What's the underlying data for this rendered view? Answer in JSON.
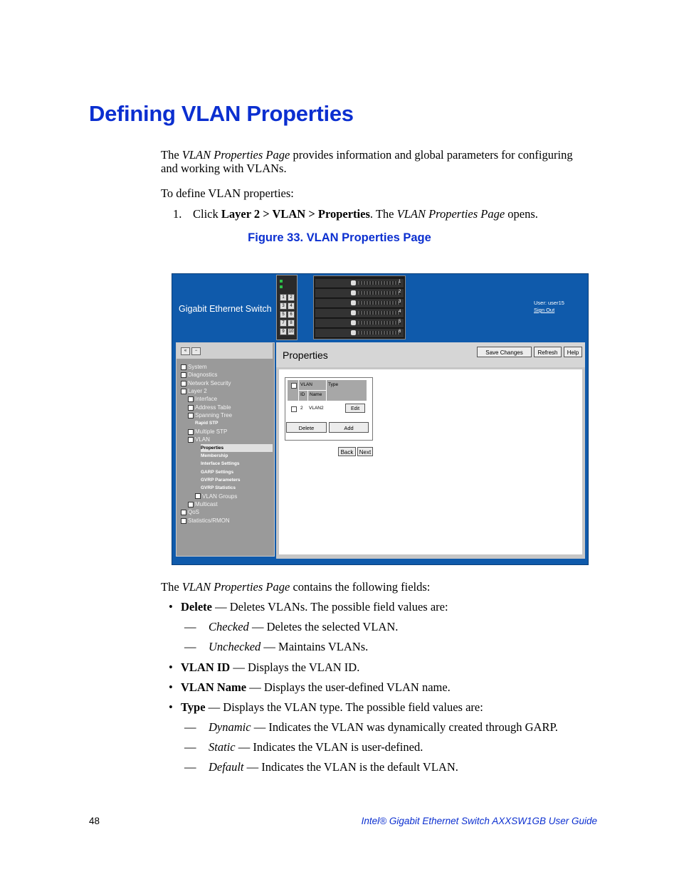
{
  "heading": "Defining VLAN Properties",
  "intro": {
    "pre": "The ",
    "italic": "VLAN Properties Page",
    "post_line1": " provides information and global parameters for configuring",
    "line2": "and working with VLANs."
  },
  "define_text": "To define VLAN properties:",
  "step1": {
    "num": "1.",
    "pre": "Click ",
    "bold": "Layer 2 > VLAN > Properties",
    "mid": ". The ",
    "italic": "VLAN Properties Page",
    "post": " opens."
  },
  "figure_caption": "Figure 33. VLAN Properties Page",
  "screenshot": {
    "brand": "Gigabit Ethernet Switch",
    "user_label": "User: user15",
    "signout": "Sign Out",
    "chassis_buttons": [
      "1",
      "2",
      "3",
      "4",
      "5",
      "6",
      "7",
      "8",
      "9",
      "10"
    ],
    "blade_numbers": [
      "1",
      "2",
      "3",
      "4",
      "5",
      "6"
    ],
    "page_title": "Properties",
    "buttons": {
      "save": "Save Changes",
      "refresh": "Refresh",
      "help": "Help"
    },
    "tree_nav_buttons": [
      "«",
      "−"
    ],
    "tree": [
      {
        "label": "System",
        "indent": 0,
        "icon": true,
        "bold": false
      },
      {
        "label": "Diagnostics",
        "indent": 0,
        "icon": true,
        "bold": false
      },
      {
        "label": "Network Security",
        "indent": 0,
        "icon": true,
        "bold": false
      },
      {
        "label": "Layer 2",
        "indent": 0,
        "icon": true,
        "bold": false
      },
      {
        "label": "Interface",
        "indent": 1,
        "icon": true,
        "bold": false
      },
      {
        "label": "Address Table",
        "indent": 1,
        "icon": true,
        "bold": false
      },
      {
        "label": "Spanning Tree",
        "indent": 1,
        "icon": true,
        "bold": false
      },
      {
        "label": "Rapid STP",
        "indent": 2,
        "icon": false,
        "bold": true
      },
      {
        "label": "Multiple STP",
        "indent": 1,
        "icon": true,
        "bold": false
      },
      {
        "label": "VLAN",
        "indent": 1,
        "icon": true,
        "bold": false
      },
      {
        "label": "Properties",
        "indent": 3,
        "icon": false,
        "bold": true,
        "selected": true
      },
      {
        "label": "Membership",
        "indent": 3,
        "icon": false,
        "bold": true
      },
      {
        "label": "Interface Settings",
        "indent": 3,
        "icon": false,
        "bold": true
      },
      {
        "label": "GARP Settings",
        "indent": 3,
        "icon": false,
        "bold": true
      },
      {
        "label": "GVRP Parameters",
        "indent": 3,
        "icon": false,
        "bold": true
      },
      {
        "label": "GVRP Statistics",
        "indent": 3,
        "icon": false,
        "bold": true
      },
      {
        "label": "VLAN Groups",
        "indent": 2,
        "icon": true,
        "bold": false
      },
      {
        "label": "Multicast",
        "indent": 1,
        "icon": true,
        "bold": false
      },
      {
        "label": "QoS",
        "indent": 0,
        "icon": true,
        "bold": false
      },
      {
        "label": "Statistics/RMON",
        "indent": 0,
        "icon": true,
        "bold": false
      }
    ],
    "table": {
      "col_vlan": "VLAN",
      "col_type": "Type",
      "col_id": "ID",
      "col_name": "Name",
      "row": {
        "id": "2",
        "name": "VLAN2",
        "edit": "Edit"
      },
      "delete": "Delete",
      "add": "Add"
    },
    "nav": {
      "back": "Back",
      "next": "Next"
    }
  },
  "fields_intro": {
    "pre": "The ",
    "italic": "VLAN Properties Page",
    "post": " contains the following fields:"
  },
  "fields": {
    "delete": {
      "term": "Delete",
      "desc": " — Deletes VLANs. The possible field values are:"
    },
    "delete_checked": {
      "term": "Checked",
      "desc": " — Deletes the selected VLAN."
    },
    "delete_unchecked": {
      "term": "Unchecked",
      "desc": " — Maintains VLANs."
    },
    "vlan_id": {
      "term": "VLAN ID",
      "desc": " — Displays the VLAN ID."
    },
    "vlan_name": {
      "term": "VLAN Name",
      "desc": " — Displays the user-defined VLAN name."
    },
    "type": {
      "term": "Type",
      "desc": " — Displays the VLAN type. The possible field values are:"
    },
    "type_dynamic": {
      "term": "Dynamic",
      "desc": " — Indicates the VLAN was dynamically created through GARP."
    },
    "type_static": {
      "term": "Static",
      "desc": " — Indicates the VLAN is user-defined."
    },
    "type_default": {
      "term": "Default",
      "desc": " — Indicates the VLAN is the default VLAN."
    }
  },
  "bullet_mark": "•",
  "dash_mark": "—",
  "footer": {
    "page": "48",
    "guide": "Intel® Gigabit Ethernet Switch AXXSW1GB User Guide"
  }
}
